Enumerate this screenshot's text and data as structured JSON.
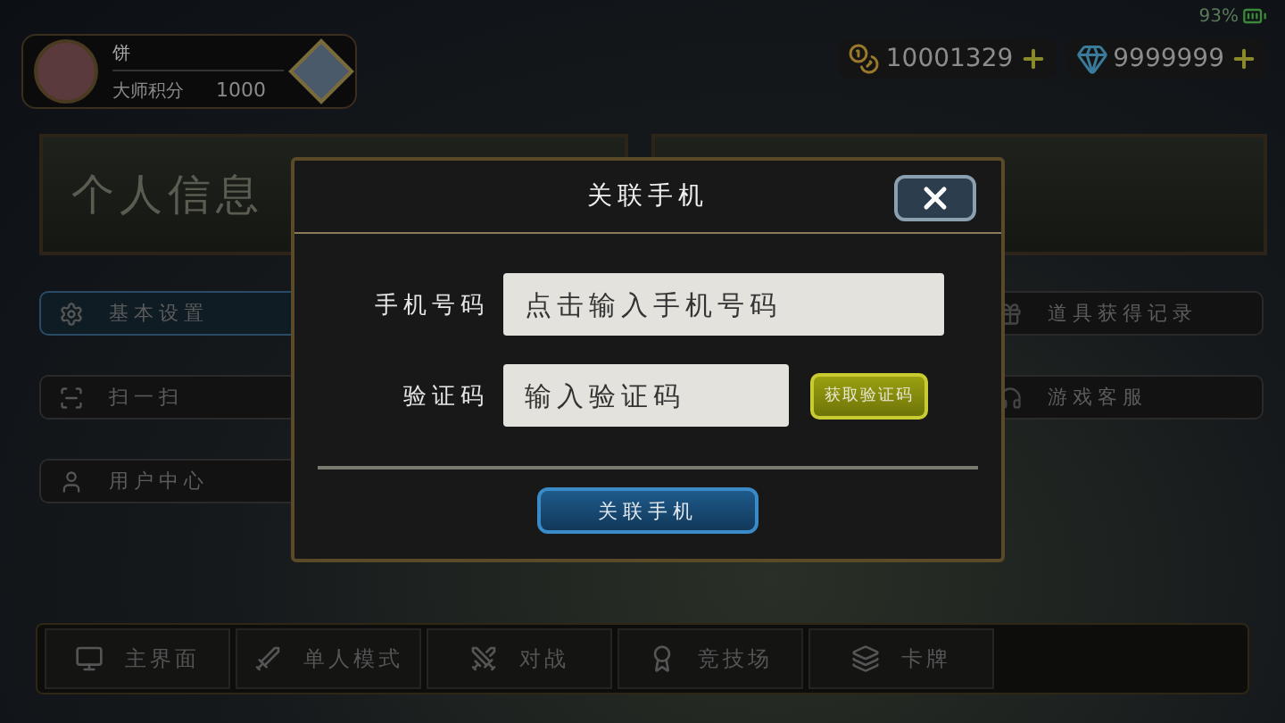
{
  "status_bar": {
    "battery": "93%"
  },
  "profile": {
    "name": "饼",
    "score_label": "大师积分",
    "score": "1000"
  },
  "currencies": [
    {
      "kind": "gold",
      "amount": "10001329"
    },
    {
      "kind": "crystal",
      "amount": "9999999"
    }
  ],
  "left_panel": {
    "title": "个人信息"
  },
  "left_menu": [
    {
      "kind": "gear",
      "label": "基本设置",
      "selected": true
    },
    {
      "kind": "scan",
      "label": "扫一扫",
      "selected": false
    },
    {
      "kind": "user",
      "label": "用户中心",
      "selected": false
    }
  ],
  "right_menu": [
    {
      "kind": "gift",
      "label": "道具获得记录"
    },
    {
      "kind": "support",
      "label": "游戏客服"
    }
  ],
  "nav": [
    {
      "kind": "home",
      "label": "主界面"
    },
    {
      "kind": "sword",
      "label": "单人模式"
    },
    {
      "kind": "swords",
      "label": "对战"
    },
    {
      "kind": "arena",
      "label": "竞技场"
    },
    {
      "kind": "cards",
      "label": "卡牌"
    }
  ],
  "dialog": {
    "title": "关联手机",
    "fields": [
      {
        "label": "手机号码",
        "placeholder": "点击输入手机号码"
      },
      {
        "label": "验证码",
        "placeholder": "输入验证码",
        "action": "获取验证码"
      }
    ],
    "submit": "关联手机"
  }
}
